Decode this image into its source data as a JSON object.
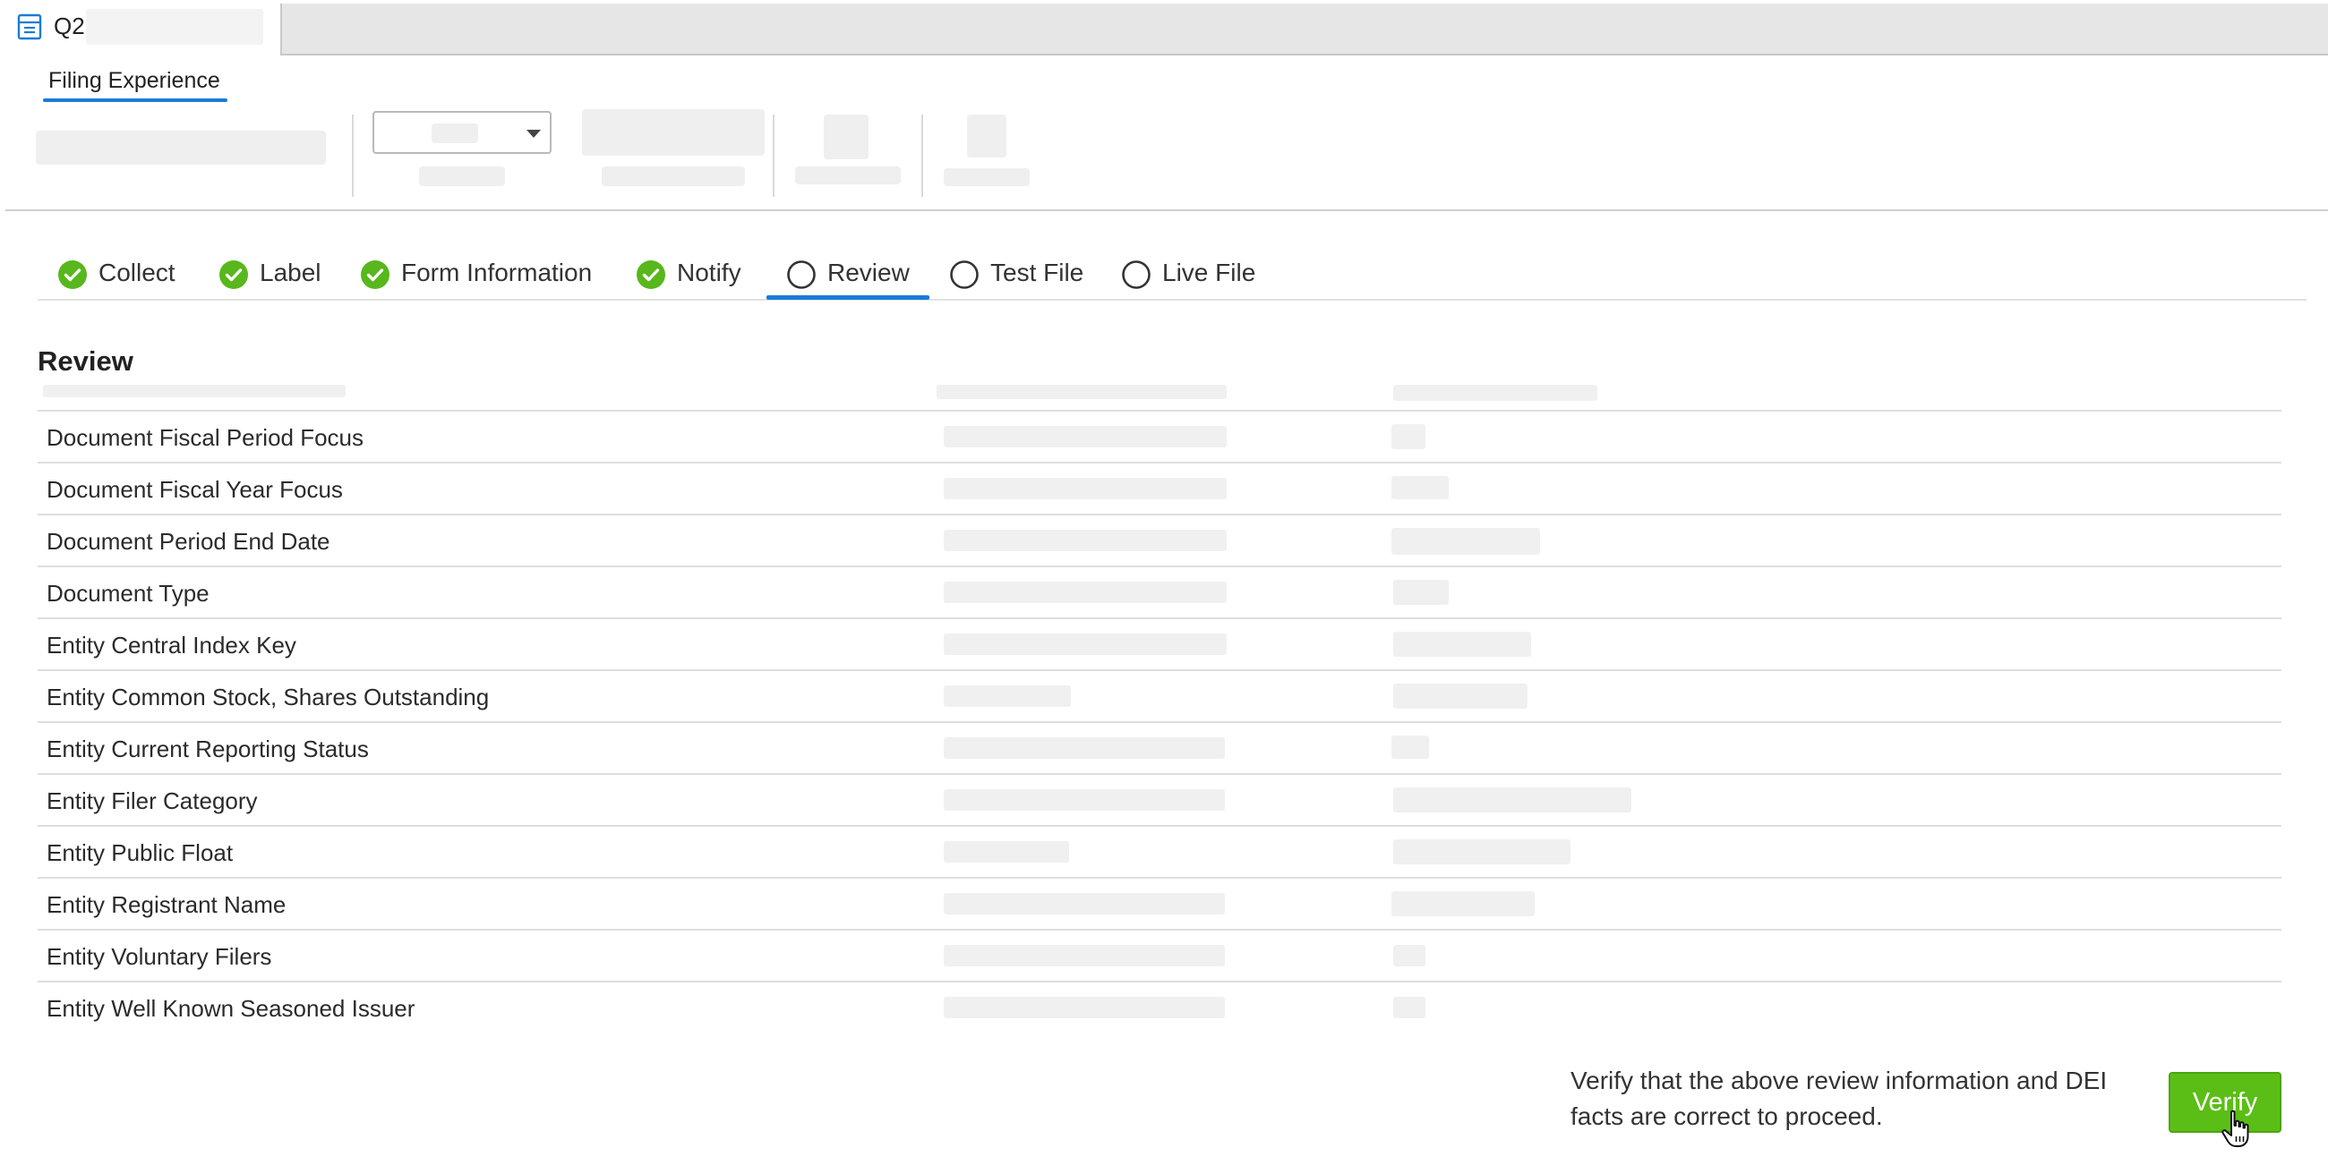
{
  "window": {
    "doc_title": "Q2",
    "icon": "document-icon"
  },
  "sub_tab": {
    "label": "Filing Experience"
  },
  "steps": [
    {
      "label": "Collect",
      "status": "complete"
    },
    {
      "label": "Label",
      "status": "complete"
    },
    {
      "label": "Form Information",
      "status": "complete"
    },
    {
      "label": "Notify",
      "status": "complete"
    },
    {
      "label": "Review",
      "status": "current"
    },
    {
      "label": "Test File",
      "status": "pending"
    },
    {
      "label": "Live File",
      "status": "pending"
    }
  ],
  "review": {
    "title": "Review",
    "rows": [
      "Document Fiscal Period Focus",
      "Document Fiscal Year Focus",
      "Document Period End Date",
      "Document Type",
      "Entity Central Index Key",
      "Entity Common Stock, Shares Outstanding",
      "Entity Current Reporting Status",
      "Entity Filer Category",
      "Entity Public Float",
      "Entity Registrant Name",
      "Entity Voluntary Filers",
      "Entity Well Known Seasoned Issuer"
    ]
  },
  "footer": {
    "message": "Verify that the above review information and DEI facts are correct to proceed.",
    "verify_label": "Verify"
  },
  "colors": {
    "accent_blue": "#1b7bd8",
    "complete_green": "#58b71c",
    "verify_green": "#5bbe16"
  }
}
